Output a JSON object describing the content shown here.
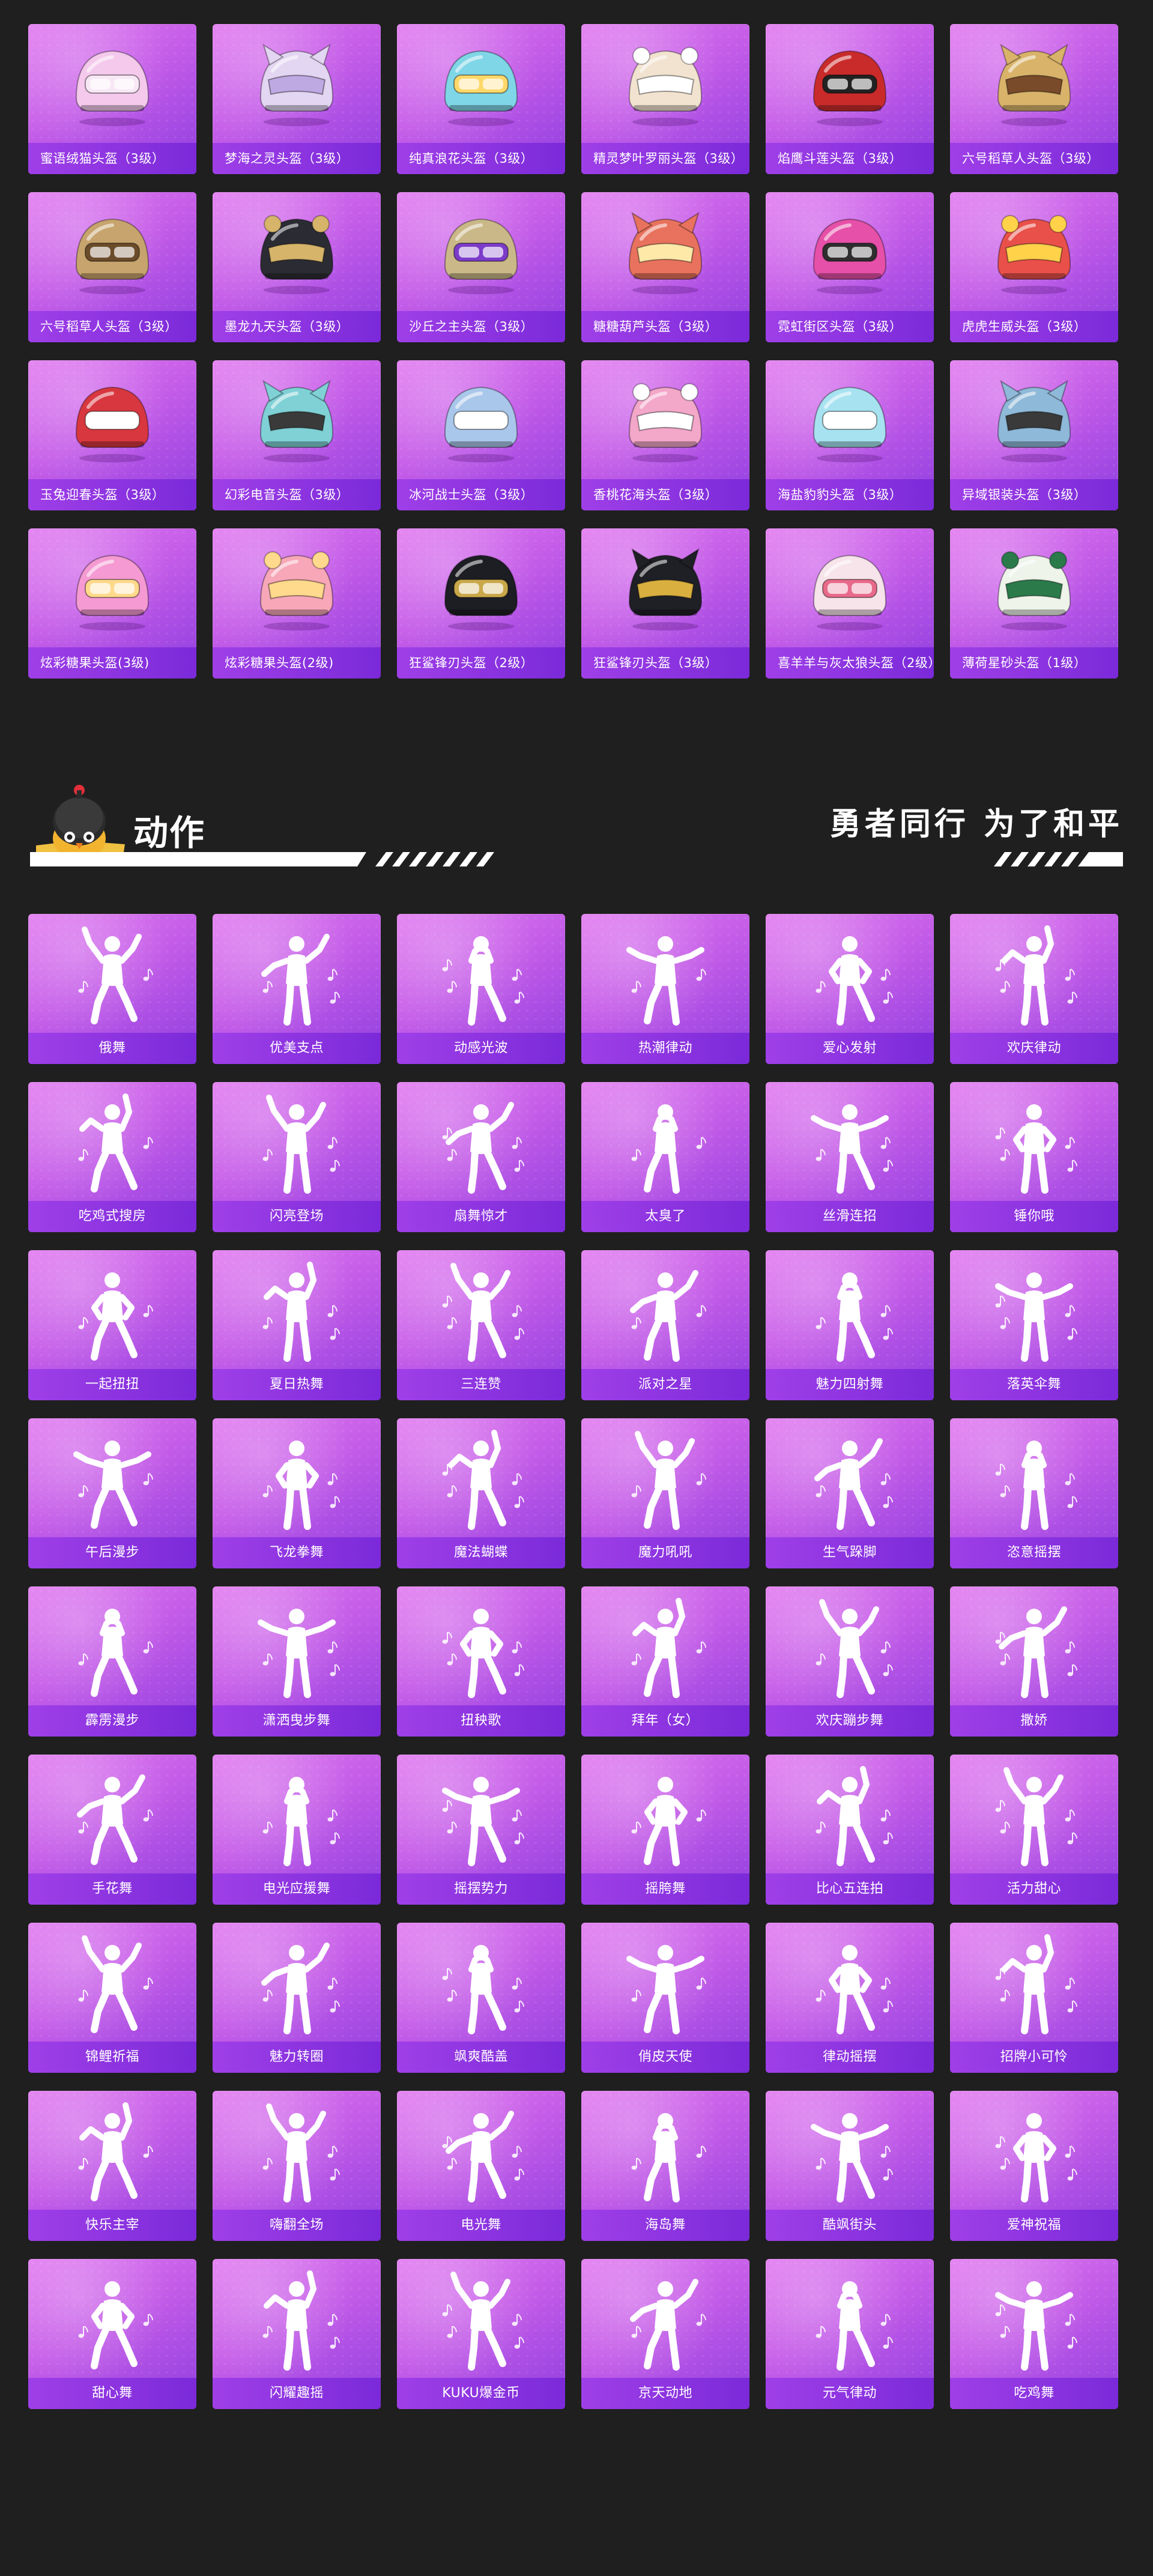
{
  "colors": {
    "page_background": "#1f1f1f",
    "card_gradient_start": "#e27bf0",
    "card_gradient_end": "#8f3ee0",
    "label_bar": "#8a34e0",
    "helmet_palette": [
      "#f4c9ec",
      "#e3d6f2",
      "#7fd6e6",
      "#f2e3d0",
      "#c92b2b",
      "#d9b36a",
      "#c7a46d",
      "#2b2b33",
      "#cbb888",
      "#e8725d",
      "#e650a8",
      "#e9504a",
      "#d8373f",
      "#7fd1d6",
      "#a9c7ea",
      "#f3a7c9",
      "#a7e2f0",
      "#8fb9d8",
      "#f59ad2",
      "#f7a7b8",
      "#1d1d24",
      "#1f1f26",
      "#f6e4ea",
      "#eef4ea"
    ],
    "helmet_accent": [
      "#f8e8f6",
      "#bfa9e2",
      "#ffd86a",
      "#ffffff",
      "#222222",
      "#7a4b2a",
      "#6b4c2a",
      "#d6b46a",
      "#7c3cc9",
      "#ffe9a8",
      "#2e2e2e",
      "#ffd24a",
      "#ffffff",
      "#3a3a3a",
      "#ffffff",
      "#ffffff",
      "#ffffff",
      "#3a3a3a",
      "#ffd98c",
      "#ffd98c",
      "#c9a84a",
      "#d9b040",
      "#e86a8a",
      "#2a7a4a"
    ]
  },
  "helmets": [
    {
      "label": "蜜语绒猫头盔（3级）",
      "icon": "pink-cat-helmet-icon"
    },
    {
      "label": "梦海之灵头盔（3级）",
      "icon": "pearl-sea-helmet-icon"
    },
    {
      "label": "纯真浪花头盔（3级）",
      "icon": "aqua-goggles-helmet-icon"
    },
    {
      "label": "精灵梦叶罗丽头盔（3级）",
      "icon": "fairy-wing-helmet-icon"
    },
    {
      "label": "焰鹰斗莲头盔（3级）",
      "icon": "red-visor-helmet-icon"
    },
    {
      "label": "六号稻草人头盔（3级）",
      "icon": "scarecrow-helmet-icon"
    },
    {
      "label": "六号稻草人头盔（3级）",
      "icon": "straw-hat-helmet-icon"
    },
    {
      "label": "墨龙九天头盔（3级）",
      "icon": "black-dragon-helmet-icon"
    },
    {
      "label": "沙丘之主头盔（3级）",
      "icon": "dune-helmet-icon"
    },
    {
      "label": "糖糖葫芦头盔（3级）",
      "icon": "candied-haws-helmet-icon"
    },
    {
      "label": "霓虹街区头盔（3级）",
      "icon": "neon-helmet-icon"
    },
    {
      "label": "虎虎生威头盔（3级）",
      "icon": "tiger-helmet-icon"
    },
    {
      "label": "玉兔迎春头盔（3级）",
      "icon": "rabbit-helmet-icon"
    },
    {
      "label": "幻彩电音头盔（3级）",
      "icon": "headphone-helmet-icon"
    },
    {
      "label": "冰河战士头盔（3级）",
      "icon": "ice-warrior-helmet-icon"
    },
    {
      "label": "香桃花海头盔（3级）",
      "icon": "peach-flower-helmet-icon"
    },
    {
      "label": "海盐豹豹头盔（3级）",
      "icon": "sea-salt-leopard-helmet-icon"
    },
    {
      "label": "异域银装头盔（3级）",
      "icon": "silver-helmet-icon"
    },
    {
      "label": "炫彩糖果头盔(3级)",
      "icon": "candy-helmet-icon"
    },
    {
      "label": "炫彩糖果头盔(2级)",
      "icon": "candy-cap-helmet-icon"
    },
    {
      "label": "狂鲨锋刃头盔（2级）",
      "icon": "shark-cap-helmet-icon"
    },
    {
      "label": "狂鲨锋刃头盔（3级）",
      "icon": "shark-helmet-icon"
    },
    {
      "label": "喜羊羊与灰太狼头盔（2级）",
      "icon": "sheep-helmet-icon"
    },
    {
      "label": "薄荷星砂头盔（1级）",
      "icon": "mint-helmet-icon"
    }
  ],
  "section": {
    "title": "动作",
    "slogan": "勇者同行 为了和平",
    "mascot_icon": "chicken-mascot-icon"
  },
  "emotes": [
    {
      "label": "俄舞"
    },
    {
      "label": "优美支点"
    },
    {
      "label": "动感光波"
    },
    {
      "label": "热潮律动"
    },
    {
      "label": "爱心发射"
    },
    {
      "label": "欢庆律动"
    },
    {
      "label": "吃鸡式搜房"
    },
    {
      "label": "闪亮登场"
    },
    {
      "label": "扇舞惊才"
    },
    {
      "label": "太臭了"
    },
    {
      "label": "丝滑连招"
    },
    {
      "label": "锤你哦"
    },
    {
      "label": "一起扭扭"
    },
    {
      "label": "夏日热舞"
    },
    {
      "label": "三连赞"
    },
    {
      "label": "派对之星"
    },
    {
      "label": "魅力四射舞"
    },
    {
      "label": "落英伞舞"
    },
    {
      "label": "午后漫步"
    },
    {
      "label": "飞龙拳舞"
    },
    {
      "label": "魔法蝴蝶"
    },
    {
      "label": "魔力吼吼"
    },
    {
      "label": "生气跺脚"
    },
    {
      "label": "恣意摇摆"
    },
    {
      "label": "霹雳漫步"
    },
    {
      "label": "潇洒曳步舞"
    },
    {
      "label": "扭秧歌"
    },
    {
      "label": "拜年（女）"
    },
    {
      "label": "欢庆蹦步舞"
    },
    {
      "label": "撒娇"
    },
    {
      "label": "手花舞"
    },
    {
      "label": "电光应援舞"
    },
    {
      "label": "摇摆势力"
    },
    {
      "label": "摇胯舞"
    },
    {
      "label": "比心五连拍"
    },
    {
      "label": "活力甜心"
    },
    {
      "label": "锦鲤祈福"
    },
    {
      "label": "魅力转圈"
    },
    {
      "label": "飒爽酷盖"
    },
    {
      "label": "俏皮天使"
    },
    {
      "label": "律动摇摆"
    },
    {
      "label": "招牌小可怜"
    },
    {
      "label": "快乐主宰"
    },
    {
      "label": "嗨翻全场"
    },
    {
      "label": "电光舞"
    },
    {
      "label": "海岛舞"
    },
    {
      "label": "酷飒街头"
    },
    {
      "label": "爱神祝福"
    },
    {
      "label": "甜心舞"
    },
    {
      "label": "闪耀趣摇"
    },
    {
      "label": "KUKU爆金币"
    },
    {
      "label": "京天动地"
    },
    {
      "label": "元气律动"
    },
    {
      "label": "吃鸡舞"
    }
  ]
}
